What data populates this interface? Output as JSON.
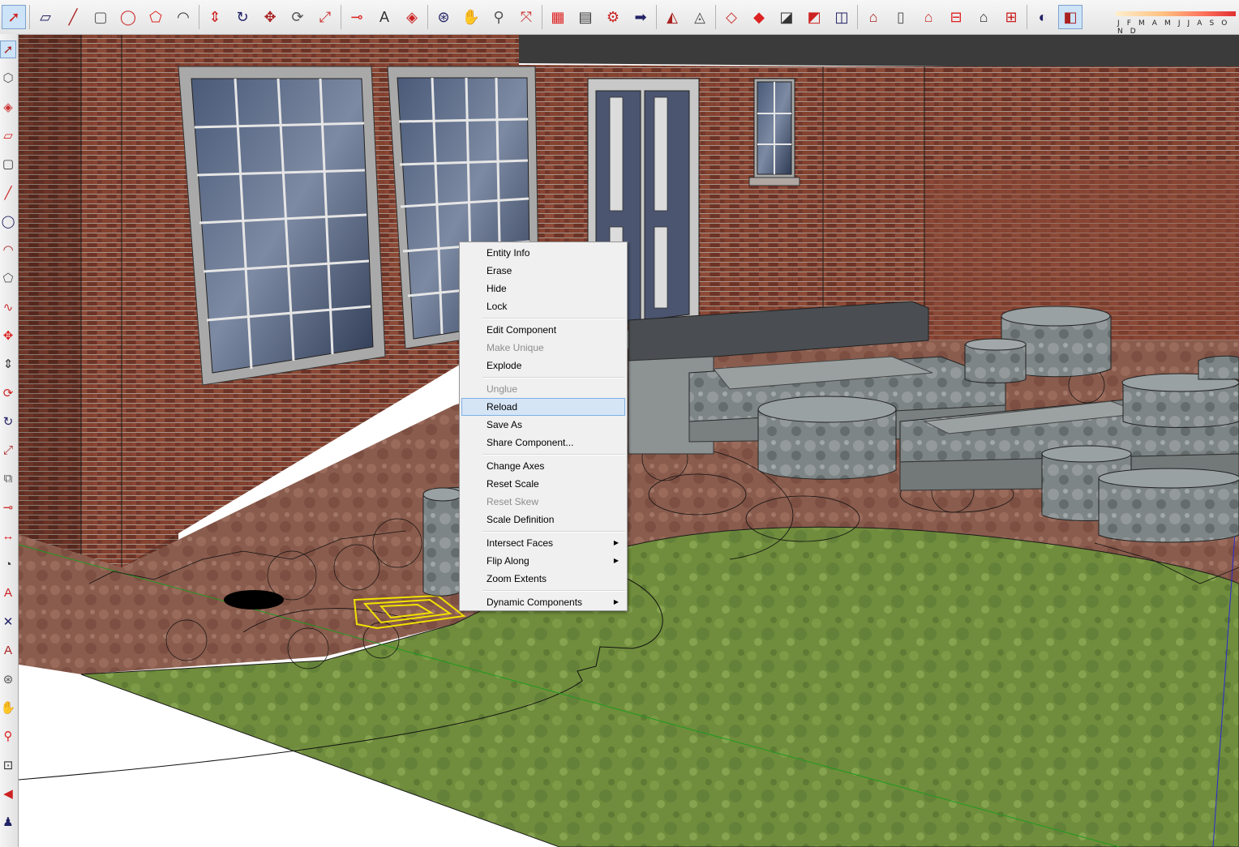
{
  "toolbar": {
    "tools": [
      "select-icon",
      "eraser-icon",
      "line-icon",
      "rectangle-icon",
      "circle-icon",
      "polygon-icon",
      "arc-icon",
      "push-pull-icon",
      "follow-me-icon",
      "move-icon",
      "rotate-icon",
      "scale-icon",
      "tape-measure-icon",
      "text-icon",
      "paint-bucket-icon",
      "orbit-icon",
      "pan-icon",
      "zoom-icon",
      "zoom-extents-icon",
      "get-models-icon",
      "share-model-icon",
      "components-icon",
      "extension-icon",
      "sandbox-smoove-icon",
      "sandbox-stamp-icon",
      "sandbox-drape-icon",
      "sandbox-add-detail-icon",
      "sandbox-flip-edge-icon",
      "sandbox-from-contours-icon",
      "sandbox-from-scratch-icon",
      "iso-view-icon",
      "front-view-icon",
      "top-view-icon",
      "right-view-icon",
      "back-view-icon",
      "left-view-icon",
      "shadows-info-icon",
      "display-shadows-icon"
    ],
    "months_label": "J F M A M J J A S O N D"
  },
  "left_toolbar": {
    "tools": [
      "select-icon",
      "make-component-icon",
      "paint-bucket-icon",
      "eraser-icon",
      "rectangle-icon",
      "line-icon",
      "circle-icon",
      "arc-icon",
      "polygon-icon",
      "freehand-icon",
      "move-icon",
      "push-pull-icon",
      "rotate-icon",
      "follow-me-icon",
      "scale-icon",
      "offset-icon",
      "tape-measure-icon",
      "dimension-icon",
      "protractor-icon",
      "text-icon",
      "axes-icon",
      "3d-text-icon",
      "orbit-icon",
      "pan-icon",
      "zoom-icon",
      "zoom-window-icon",
      "previous-view-icon",
      "walk-icon"
    ]
  },
  "context_menu": {
    "groups": [
      [
        {
          "label": "Entity Info",
          "enabled": true
        },
        {
          "label": "Erase",
          "enabled": true
        },
        {
          "label": "Hide",
          "enabled": true
        },
        {
          "label": "Lock",
          "enabled": true
        }
      ],
      [
        {
          "label": "Edit Component",
          "enabled": true
        },
        {
          "label": "Make Unique",
          "enabled": false
        },
        {
          "label": "Explode",
          "enabled": true
        }
      ],
      [
        {
          "label": "Unglue",
          "enabled": false
        },
        {
          "label": "Reload",
          "enabled": true,
          "highlighted": true
        },
        {
          "label": "Save As",
          "enabled": true
        },
        {
          "label": "Share Component...",
          "enabled": true
        }
      ],
      [
        {
          "label": "Change Axes",
          "enabled": true
        },
        {
          "label": "Reset Scale",
          "enabled": true
        },
        {
          "label": "Reset Skew",
          "enabled": false
        },
        {
          "label": "Scale Definition",
          "enabled": true
        }
      ],
      [
        {
          "label": "Intersect Faces",
          "enabled": true,
          "submenu": true
        },
        {
          "label": "Flip Along",
          "enabled": true,
          "submenu": true
        },
        {
          "label": "Zoom Extents",
          "enabled": true
        }
      ],
      [
        {
          "label": "Dynamic Components",
          "enabled": true,
          "submenu": true
        }
      ]
    ]
  },
  "colors": {
    "brick": "#7a3b2c",
    "grass": "#6e8c3a",
    "paver": "#8a5a4c",
    "stone": "#7d8485",
    "window_glass": "#3a4a66",
    "selection": "#f2e200"
  }
}
